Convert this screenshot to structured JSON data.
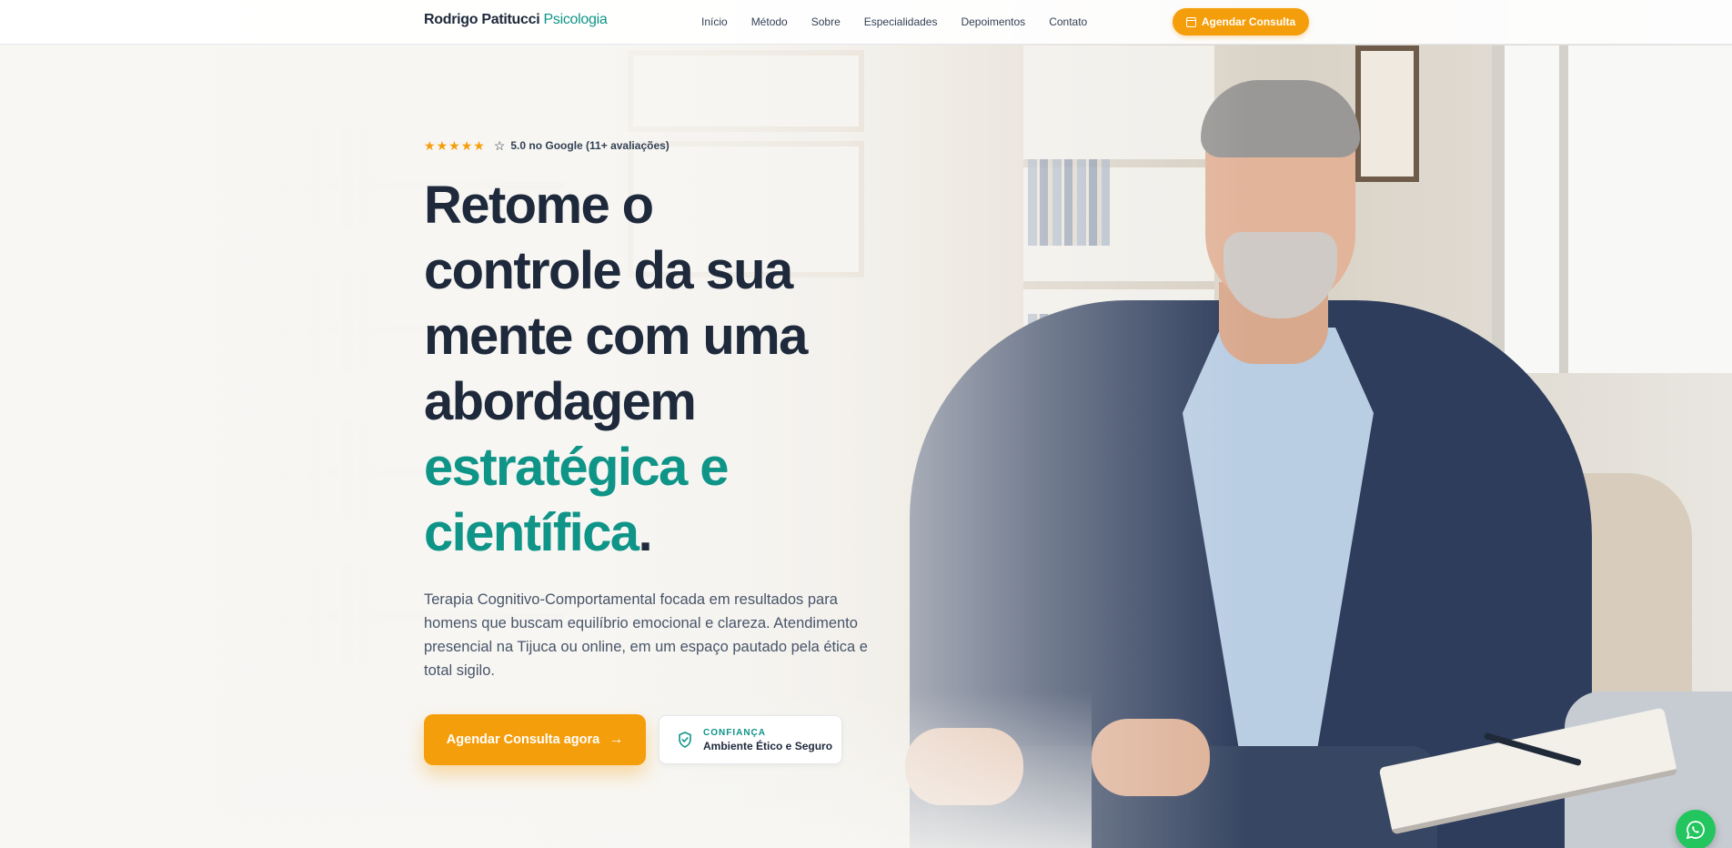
{
  "nav": {
    "brand_name": "Rodrigo Patitucci",
    "brand_accent": "Psicologia",
    "links": [
      "Início",
      "Método",
      "Sobre",
      "Especialidades",
      "Depoimentos",
      "Contato"
    ],
    "cta_label": "Agendar Consulta"
  },
  "hero": {
    "rating": {
      "stars": 5,
      "text": "5.0 no Google (11+ avaliações)"
    },
    "headline_line1": "Retome o",
    "headline_line2": "controle da sua",
    "headline_line3": "mente com uma",
    "headline_line4": "abordagem",
    "headline_highlight1": "estratégica e",
    "headline_highlight2": "científica",
    "headline_period": ".",
    "lead": "Terapia Cognitivo-Comportamental focada em resultados para homens que buscam equilíbrio emocional e clareza. Atendimento presencial na Tijuca ou online, em um espaço pautado pela ética e total sigilo.",
    "primary_cta": "Agendar Consulta agora",
    "trust_eyebrow": "CONFIANÇA",
    "trust_title": "Ambiente Ético e Seguro"
  },
  "icons": {
    "calendar": "calendar-icon",
    "star": "star-icon",
    "arrow": "arrow-right-icon",
    "shield": "shield-check-icon",
    "whatsapp": "whatsapp-icon"
  },
  "colors": {
    "accent_teal": "#0f9488",
    "accent_orange": "#f59e0b",
    "text_dark": "#1e293b",
    "whatsapp_green": "#22c55e"
  }
}
